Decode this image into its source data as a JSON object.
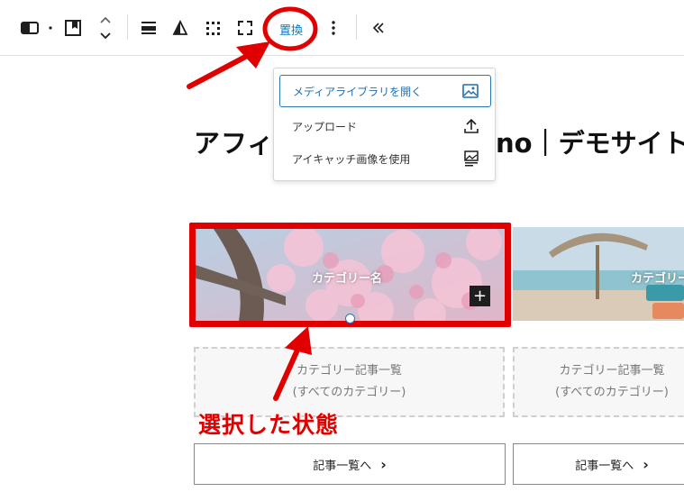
{
  "toolbar": {
    "replace_label": "置換",
    "icons": [
      "block-type-icon",
      "bookmark-icon",
      "move-up-down-icon",
      "align-icon",
      "filter-icon",
      "grid-icon",
      "fullscreen-icon",
      "more-options-icon",
      "collapse-icon"
    ]
  },
  "replace_menu": {
    "items": [
      {
        "label": "メディアライブラリを開く",
        "icon": "image-icon"
      },
      {
        "label": "アップロード",
        "icon": "upload-icon"
      },
      {
        "label": "アイキャッチ画像を使用",
        "icon": "featured-image-icon"
      }
    ]
  },
  "page": {
    "title_start": "アフィ",
    "title_end": "no｜デモサイト"
  },
  "cards": [
    {
      "category_label": "カテゴリー名",
      "placeholder_line1": "カテゴリー記事一覧",
      "placeholder_line2": "(すべてのカテゴリー)",
      "button_label": "記事一覧へ",
      "image": "cherry-blossom"
    },
    {
      "category_label": "カテゴリー名",
      "placeholder_line1": "カテゴリー記事一覧",
      "placeholder_line2": "(すべてのカテゴリー)",
      "button_label": "記事一覧へ",
      "image": "beach"
    }
  ],
  "annotation": {
    "text": "選択した状態"
  },
  "colors": {
    "accent": "#0a7bbf",
    "highlight": "#e10000",
    "focus": "#2b78b6"
  }
}
